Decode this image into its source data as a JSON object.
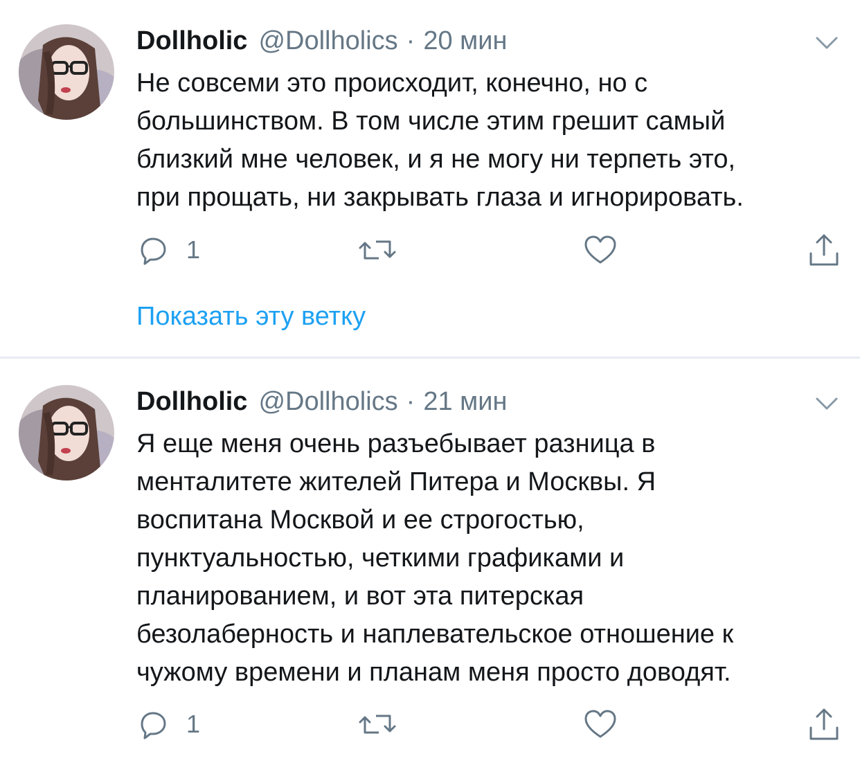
{
  "tweets": [
    {
      "display_name": "Dollholic",
      "handle": "@Dollholics",
      "separator": "·",
      "time": "20 мин",
      "text_lines": [
        "Не совсеми это происходит,  конечно,  но с",
        "большинством. В том числе этим грешит самый",
        "близкий мне человек, и я не могу ни терпеть это,",
        "при прощать, ни закрывать глаза и игнорировать."
      ],
      "reply_count": "1",
      "show_thread_label": "Показать эту ветку",
      "icons": [
        "avatar",
        "chevron-down-icon",
        "reply-icon",
        "retweet-icon",
        "like-icon",
        "share-icon"
      ]
    },
    {
      "display_name": "Dollholic",
      "handle": "@Dollholics",
      "separator": "·",
      "time": "21 мин",
      "text_lines": [
        "Я еще меня очень разъебывает разница в",
        "менталитете жителей Питера и Москвы. Я",
        "воспитана Москвой и ее строгостью,",
        "пунктуальностью, четкими графиками и",
        "планированием, и вот эта питерская",
        "безолаберность и наплевательское отношение к",
        "чужому времени и планам меня просто доводят."
      ],
      "reply_count": "1",
      "icons": [
        "avatar",
        "chevron-down-icon",
        "reply-icon",
        "retweet-icon",
        "like-icon",
        "share-icon"
      ]
    }
  ],
  "colors": {
    "text": "#14171a",
    "secondary": "#657786",
    "link": "#1da1f2",
    "divider": "#e6ecf0"
  }
}
